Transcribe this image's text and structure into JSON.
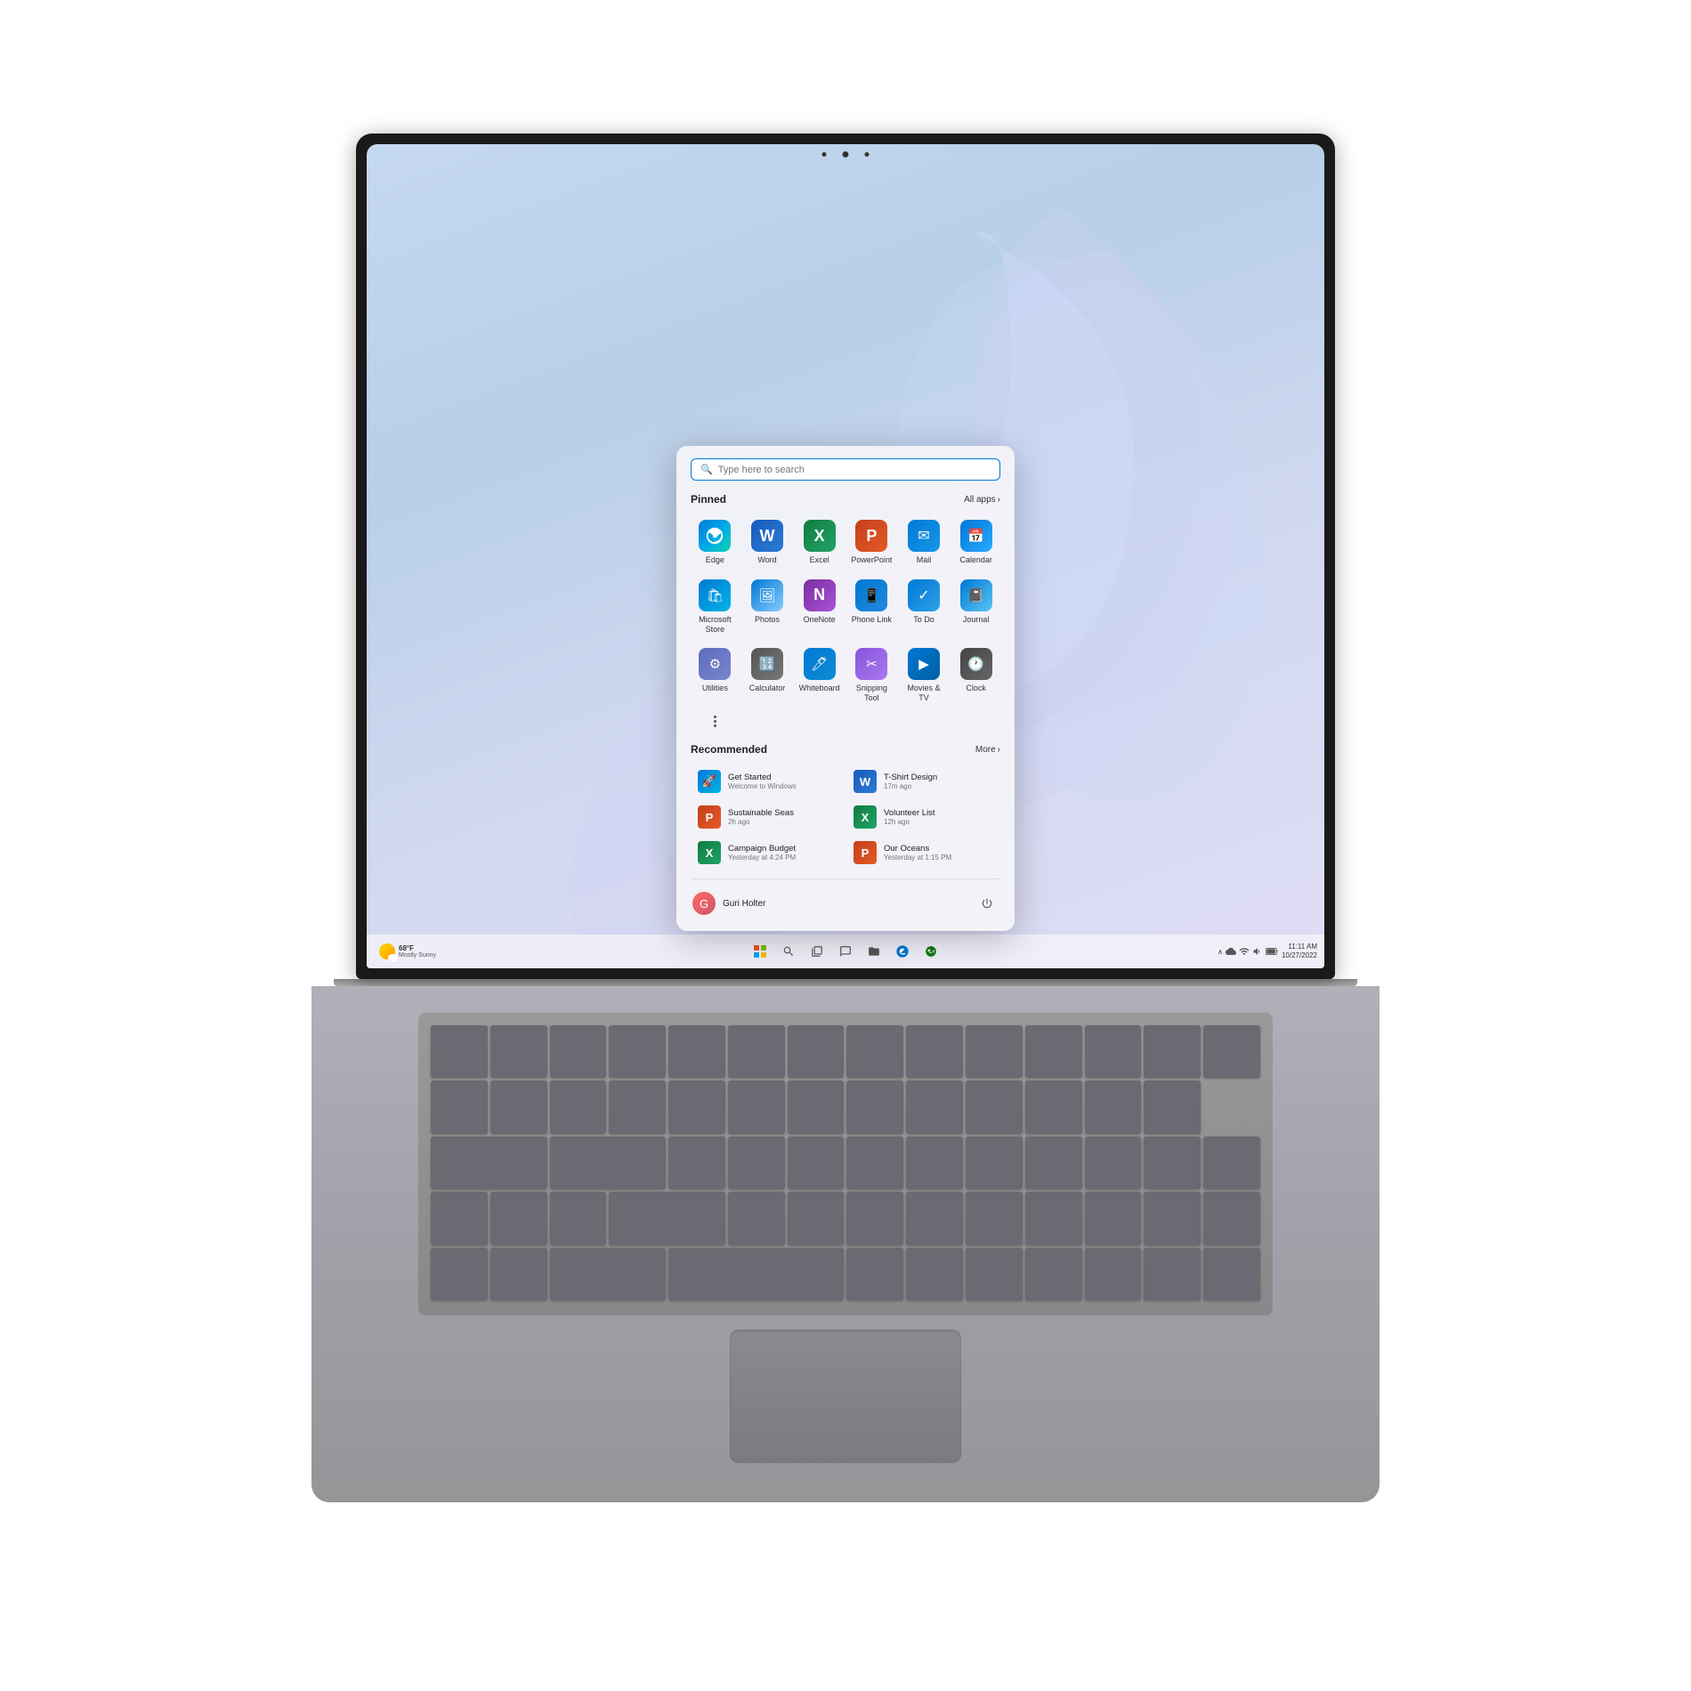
{
  "laptop": {
    "screen": {
      "wallpaper_colors": [
        "#c5d8f0",
        "#b8cfe8",
        "#d0d8f0",
        "#e0ddf5"
      ]
    }
  },
  "taskbar": {
    "weather": {
      "temperature": "68°F",
      "condition": "Mostly Sunny"
    },
    "clock": {
      "time": "11:11 AM",
      "date": "10/27/2022"
    },
    "icons": [
      "windows",
      "search",
      "task-view",
      "chat",
      "file-explorer",
      "edge",
      "xbox"
    ]
  },
  "start_menu": {
    "search": {
      "placeholder": "Type here to search"
    },
    "pinned": {
      "title": "Pinned",
      "all_apps_label": "All apps",
      "apps": [
        {
          "name": "Edge",
          "icon_class": "icon-edge",
          "symbol": "e"
        },
        {
          "name": "Word",
          "icon_class": "icon-word",
          "symbol": "W"
        },
        {
          "name": "Excel",
          "icon_class": "icon-excel",
          "symbol": "X"
        },
        {
          "name": "PowerPoint",
          "icon_class": "icon-ppt",
          "symbol": "P"
        },
        {
          "name": "Mail",
          "icon_class": "icon-mail",
          "symbol": "✉"
        },
        {
          "name": "Calendar",
          "icon_class": "icon-calendar",
          "symbol": "📅"
        },
        {
          "name": "Microsoft Store",
          "icon_class": "icon-store",
          "symbol": "🛍"
        },
        {
          "name": "Photos",
          "icon_class": "icon-photos",
          "symbol": "🖼"
        },
        {
          "name": "OneNote",
          "icon_class": "icon-onenote",
          "symbol": "N"
        },
        {
          "name": "Phone Link",
          "icon_class": "icon-phonelink",
          "symbol": "📱"
        },
        {
          "name": "To Do",
          "icon_class": "icon-todo",
          "symbol": "✓"
        },
        {
          "name": "Journal",
          "icon_class": "icon-journal",
          "symbol": "📓"
        },
        {
          "name": "Utilities",
          "icon_class": "icon-utilities",
          "symbol": "⚙"
        },
        {
          "name": "Calculator",
          "icon_class": "icon-calculator",
          "symbol": "🔢"
        },
        {
          "name": "Whiteboard",
          "icon_class": "icon-whiteboard",
          "symbol": "🖊"
        },
        {
          "name": "Snipping Tool",
          "icon_class": "icon-snipping",
          "symbol": "✂"
        },
        {
          "name": "Movies & TV",
          "icon_class": "icon-movies",
          "symbol": "▶"
        },
        {
          "name": "Clock",
          "icon_class": "icon-clock",
          "symbol": "🕐"
        }
      ]
    },
    "recommended": {
      "title": "Recommended",
      "more_label": "More",
      "items": [
        {
          "name": "Get Started",
          "subtitle": "Welcome to Windows",
          "icon_class": "icon-store",
          "symbol": "🚀"
        },
        {
          "name": "T-Shirt Design",
          "subtitle": "17m ago",
          "icon_class": "icon-word",
          "symbol": "W"
        },
        {
          "name": "Sustainable Seas",
          "subtitle": "2h ago",
          "icon_class": "icon-ppt",
          "symbol": "P"
        },
        {
          "name": "Volunteer List",
          "subtitle": "12h ago",
          "icon_class": "icon-excel",
          "symbol": "X"
        },
        {
          "name": "Campaign Budget",
          "subtitle": "Yesterday at 4:24 PM",
          "icon_class": "icon-excel",
          "symbol": "X"
        },
        {
          "name": "Our Oceans",
          "subtitle": "Yesterday at 1:15 PM",
          "icon_class": "icon-ppt",
          "symbol": "P"
        }
      ]
    },
    "user": {
      "name": "Guri Holter",
      "avatar_letter": "G"
    }
  }
}
